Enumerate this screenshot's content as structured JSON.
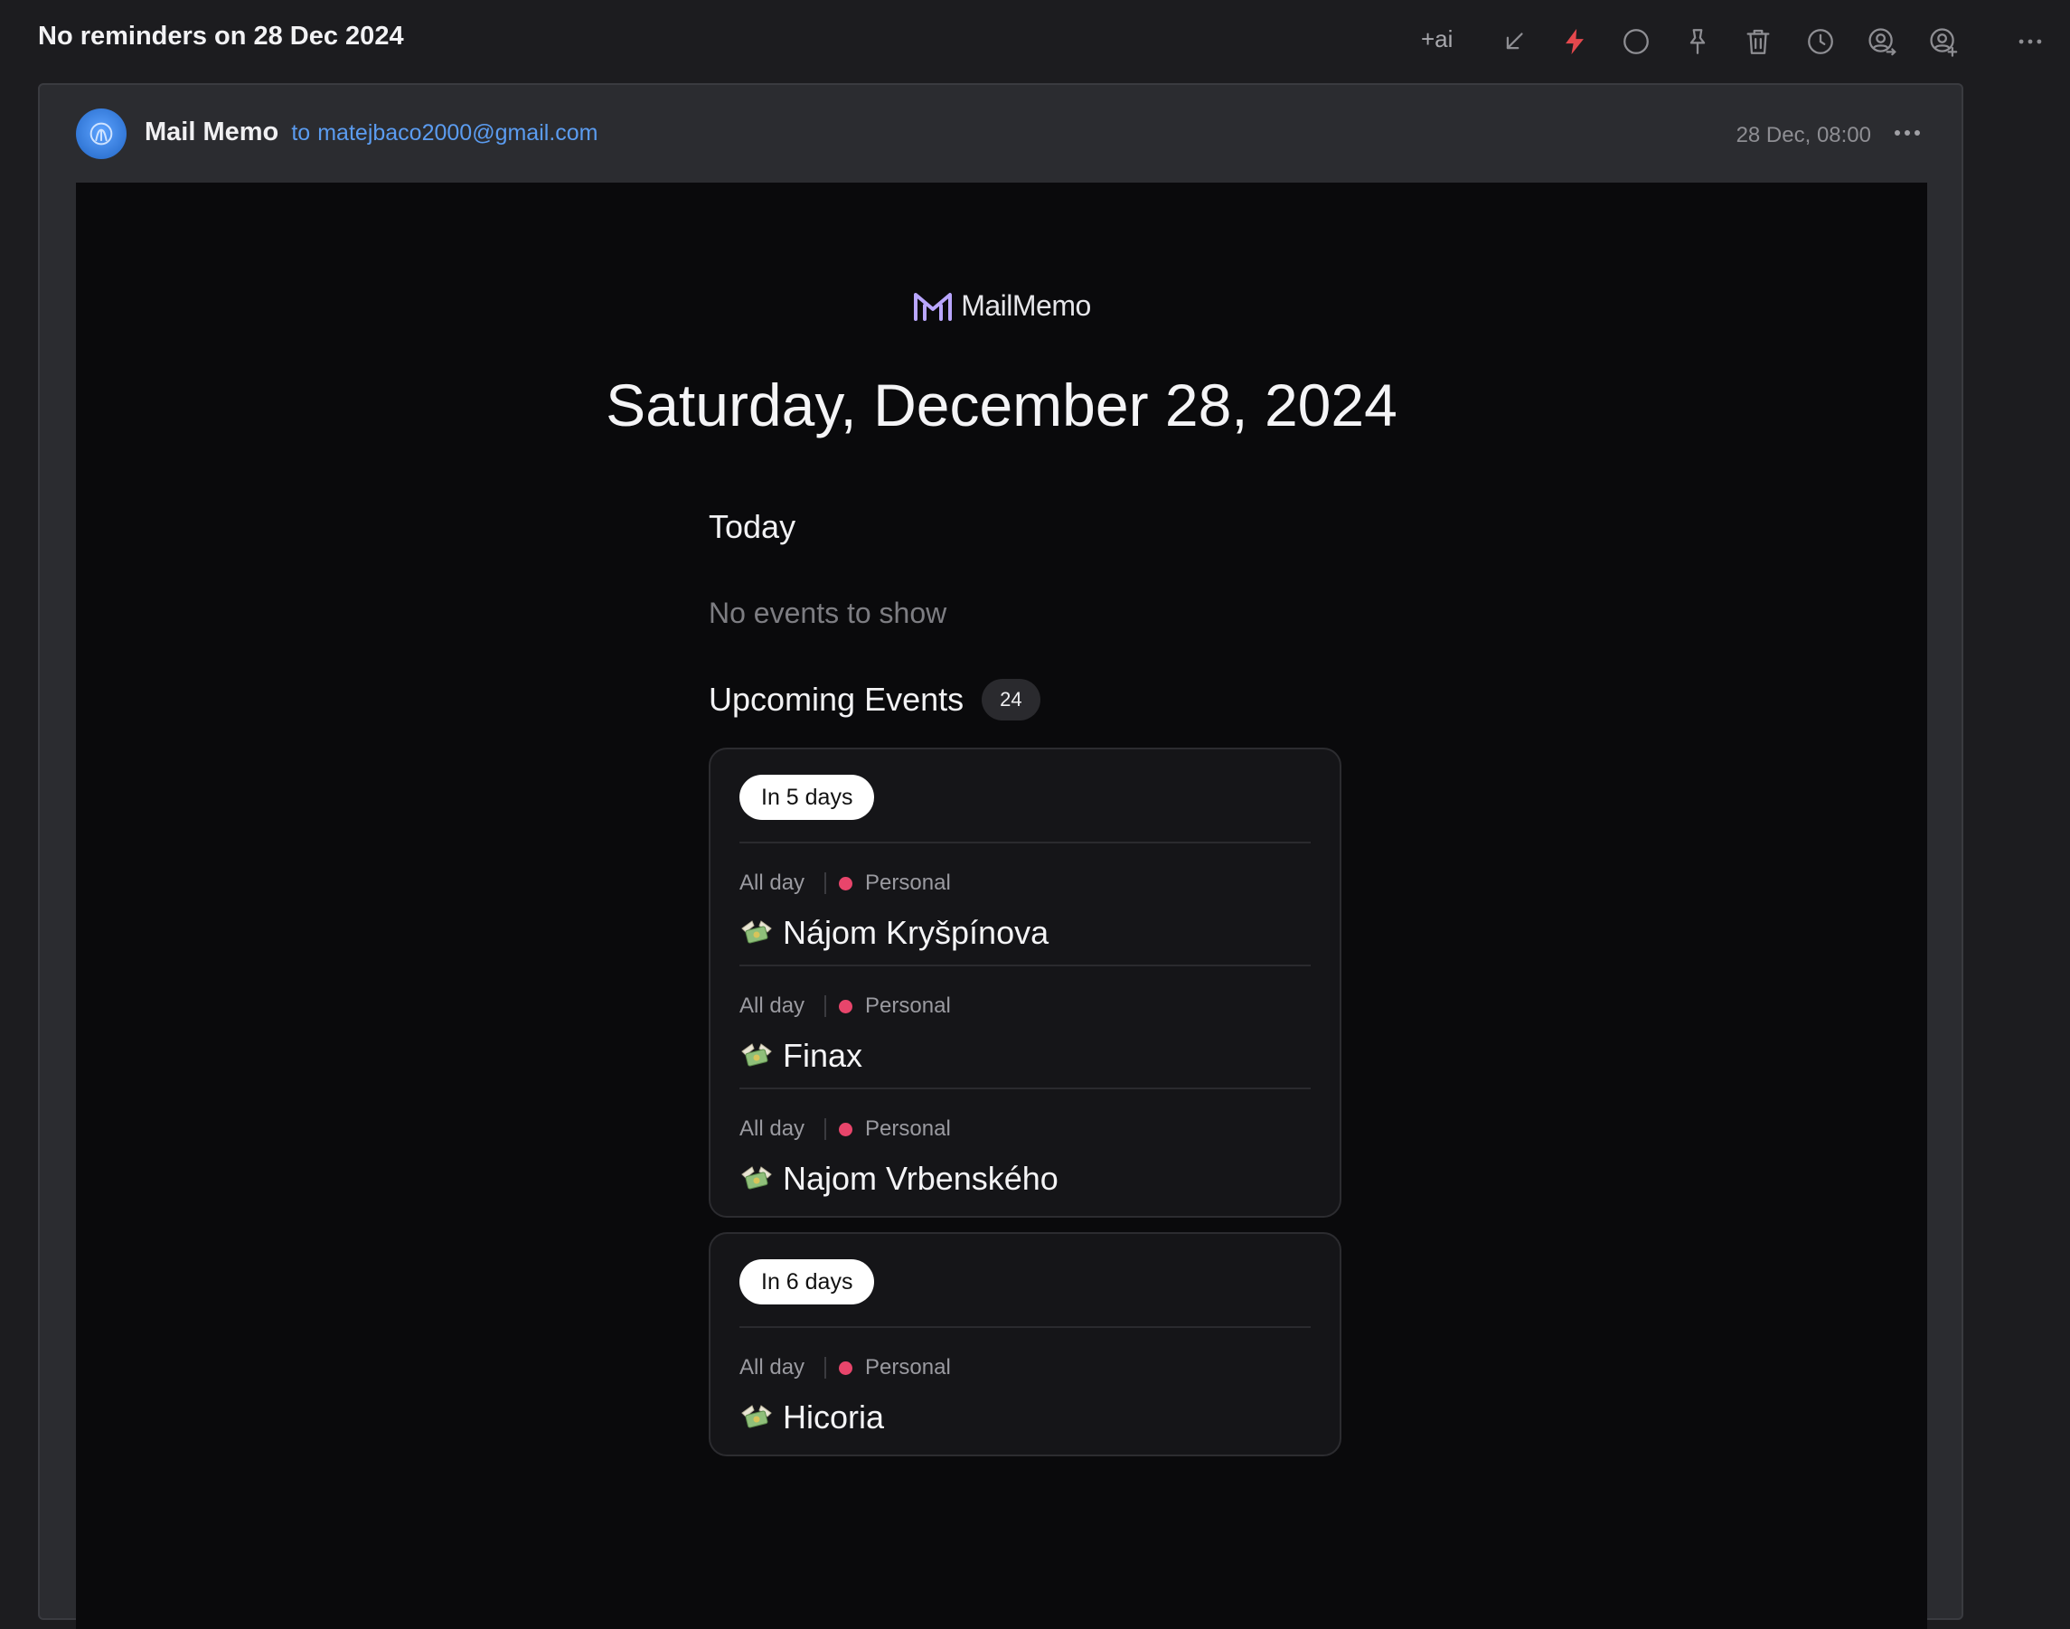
{
  "header": {
    "subject": "No reminders on 28 Dec 2024",
    "ai_label": "+ai",
    "toolbar_icons": [
      "collapse-arrow",
      "lightning",
      "circle",
      "pin",
      "trash",
      "clock",
      "contact-forward",
      "contact-add",
      "more"
    ],
    "accent_lightning": "#e5484d"
  },
  "message": {
    "sender_name": "Mail Memo",
    "to_label": "to",
    "to_email": "matejbaco2000@gmail.com",
    "date": "28 Dec, 08:00"
  },
  "email": {
    "brand_name": "MailMemo",
    "date_heading": "Saturday, December 28, 2024",
    "today_title": "Today",
    "no_events": "No events to show",
    "upcoming_title": "Upcoming Events",
    "upcoming_count": "24",
    "groups": [
      {
        "when": "In 5 days",
        "events": [
          {
            "time": "All day",
            "calendar": "Personal",
            "title": "Nájom Kryšpínova"
          },
          {
            "time": "All day",
            "calendar": "Personal",
            "title": "Finax"
          },
          {
            "time": "All day",
            "calendar": "Personal",
            "title": "Najom Vrbenského"
          }
        ]
      },
      {
        "when": "In 6 days",
        "events": [
          {
            "time": "All day",
            "calendar": "Personal",
            "title": "Hicoria"
          }
        ]
      }
    ],
    "calendar_color": "#e8456b"
  }
}
